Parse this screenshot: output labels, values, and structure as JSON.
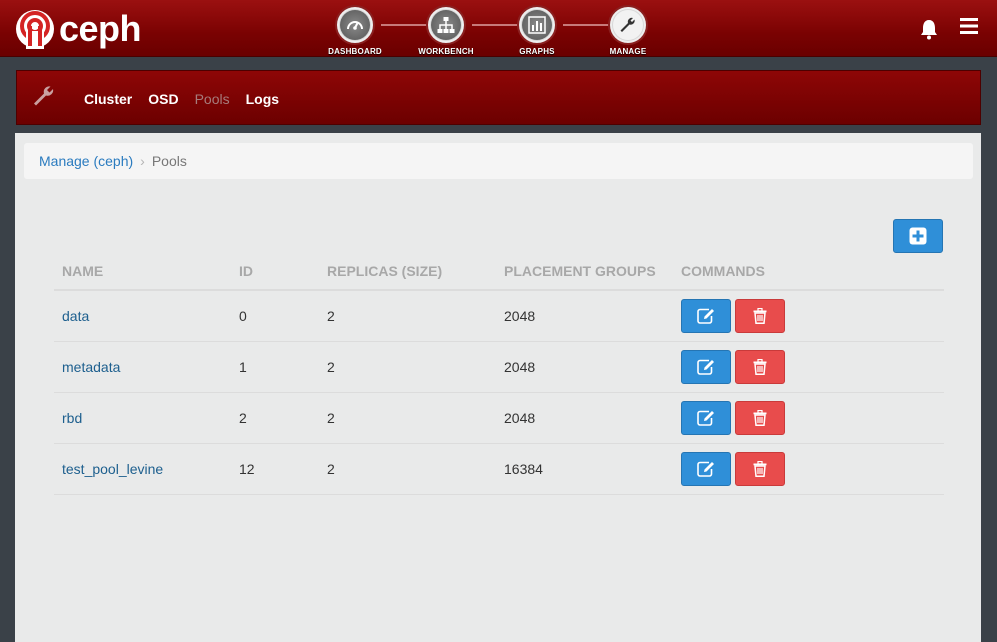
{
  "app": {
    "name": "ceph"
  },
  "colors": {
    "brand": "#7a0202",
    "primary": "#2f8fd8",
    "danger": "#e84c4c",
    "link": "#2a7bbf"
  },
  "steps": [
    {
      "label": "DASHBOARD",
      "icon": "gauge-icon",
      "active": false
    },
    {
      "label": "WORKBENCH",
      "icon": "sitemap-icon",
      "active": false
    },
    {
      "label": "GRAPHS",
      "icon": "bar-chart-icon",
      "active": false
    },
    {
      "label": "MANAGE",
      "icon": "wrench-icon",
      "active": true
    }
  ],
  "header_icons": [
    "bell-icon",
    "hamburger-menu-icon"
  ],
  "subnav": {
    "icon": "wrench-icon",
    "links": [
      {
        "label": "Cluster",
        "current": false
      },
      {
        "label": "OSD",
        "current": false
      },
      {
        "label": "Pools",
        "current": true
      },
      {
        "label": "Logs",
        "current": false
      }
    ]
  },
  "breadcrumb": {
    "parent": "Manage (ceph)",
    "current": "Pools"
  },
  "add_button_icon": "plus-square-icon",
  "table": {
    "headers": [
      "NAME",
      "ID",
      "REPLICAS (SIZE)",
      "PLACEMENT GROUPS",
      "COMMANDS"
    ],
    "rows": [
      {
        "name": "data",
        "id": "0",
        "replicas": "2",
        "pg": "2048"
      },
      {
        "name": "metadata",
        "id": "1",
        "replicas": "2",
        "pg": "2048"
      },
      {
        "name": "rbd",
        "id": "2",
        "replicas": "2",
        "pg": "2048"
      },
      {
        "name": "test_pool_levine",
        "id": "12",
        "replicas": "2",
        "pg": "16384"
      }
    ],
    "command_icons": [
      "edit-icon",
      "trash-icon"
    ]
  }
}
